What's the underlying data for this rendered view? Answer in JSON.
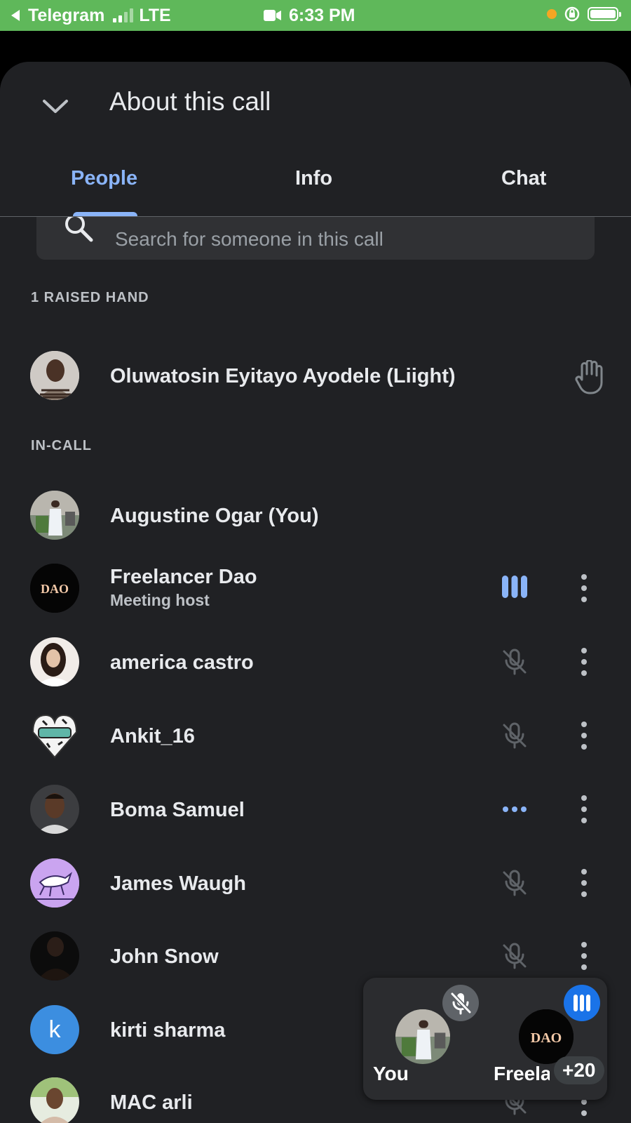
{
  "status_bar": {
    "back_app": "Telegram",
    "network": "LTE",
    "time": "6:33 PM"
  },
  "header": {
    "title": "About this call",
    "tabs": [
      {
        "label": "People",
        "active": true
      },
      {
        "label": "Info",
        "active": false
      },
      {
        "label": "Chat",
        "active": false
      }
    ]
  },
  "search": {
    "placeholder": "Search for someone in this call"
  },
  "sections": {
    "raised_hand": "1 RAISED HAND",
    "in_call": "IN-CALL"
  },
  "raised_hand_people": [
    {
      "name": "Oluwatosin Eyitayo Ayodele (Liight)",
      "icon": "raised-hand-icon"
    }
  ],
  "participants": [
    {
      "name": "Augustine Ogar (You)",
      "subtitle": "",
      "status_icon": "none"
    },
    {
      "name": "Freelancer Dao",
      "subtitle": "Meeting host",
      "status_icon": "audio-level-icon"
    },
    {
      "name": "america castro",
      "subtitle": "",
      "status_icon": "mic-off-icon"
    },
    {
      "name": "Ankit_16",
      "subtitle": "",
      "status_icon": "mic-off-icon"
    },
    {
      "name": "Boma Samuel",
      "subtitle": "",
      "status_icon": "connecting-dots-icon"
    },
    {
      "name": "James Waugh",
      "subtitle": "",
      "status_icon": "mic-off-icon"
    },
    {
      "name": "John Snow",
      "subtitle": "",
      "status_icon": "mic-off-icon"
    },
    {
      "name": "kirti sharma",
      "subtitle": "",
      "avatar_letter": "k",
      "status_icon": "none"
    },
    {
      "name": "MAC arli",
      "subtitle": "",
      "status_icon": "mic-off-icon"
    }
  ],
  "pip": {
    "self_label": "You",
    "other_label": "Freela",
    "other_count": "+20",
    "dao_logo_text": "DAO"
  },
  "colors": {
    "status_bar": "#5fb85a",
    "sheet_bg": "#202124",
    "accent": "#8ab4f8",
    "avatar_kirti": "#3c8ee0"
  }
}
